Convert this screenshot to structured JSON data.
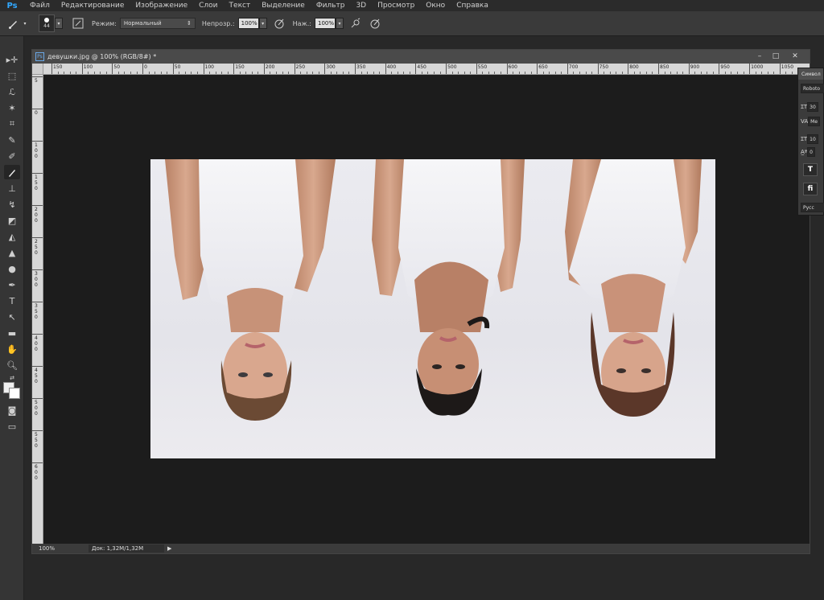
{
  "app": {
    "logo": "Ps"
  },
  "menu": [
    "Файл",
    "Редактирование",
    "Изображение",
    "Слои",
    "Текст",
    "Выделение",
    "Фильтр",
    "3D",
    "Просмотр",
    "Окно",
    "Справка"
  ],
  "options": {
    "brush_size": "44",
    "mode_label": "Режим:",
    "mode_value": "Нормальный",
    "opacity_label": "Непрозр.:",
    "opacity_value": "100%",
    "flow_label": "Наж.:",
    "flow_value": "100%"
  },
  "document": {
    "title": "девушки.jpg @ 100% (RGB/8#) *",
    "ps_badge": "Ps",
    "zoom": "100%",
    "doc_size": "Док: 1,32M/1,32M",
    "ruler_h": [
      "150",
      "100",
      "50",
      "0",
      "50",
      "100",
      "150",
      "200",
      "250",
      "300",
      "350",
      "400",
      "450",
      "500",
      "550",
      "600",
      "650",
      "700",
      "750",
      "800",
      "850",
      "900",
      "950",
      "1000",
      "1050"
    ],
    "ruler_v": [
      "5",
      "0",
      "1\n0\n0",
      "1\n5\n0",
      "2\n0\n0",
      "2\n5\n0",
      "3\n0\n0",
      "3\n5\n0",
      "4\n0\n0",
      "4\n5\n0",
      "5\n0\n0",
      "5\n5\n0",
      "6\n0\n0"
    ]
  },
  "char_panel": {
    "title": "Символ",
    "font": "Roboto",
    "size": "30",
    "tracking": "Ме",
    "vscale": "10",
    "baseline": "0",
    "lang": "Русс",
    "t_btn": "T",
    "fi_btn": "fi"
  },
  "colors": {
    "accent": "#31a8ff"
  }
}
